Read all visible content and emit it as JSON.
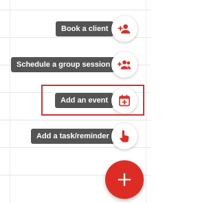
{
  "actions": [
    {
      "label": "Book a client",
      "icon": "add-person-icon"
    },
    {
      "label": "Schedule a group session",
      "icon": "add-group-icon"
    },
    {
      "label": "Add an event",
      "icon": "calendar-add-icon"
    },
    {
      "label": "Add a task/reminder",
      "icon": "hand-pointer-icon"
    }
  ],
  "fab": {
    "icon": "plus-icon"
  },
  "colors": {
    "accent": "#dd2c24",
    "label_bg": "#545454",
    "highlight": "#d32f2f"
  }
}
